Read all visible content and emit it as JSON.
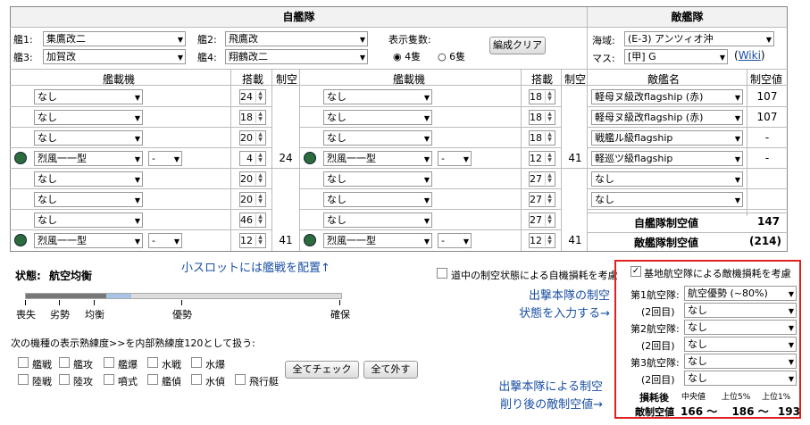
{
  "headers": {
    "own_fleet": "自艦隊",
    "enemy_fleet": "敵艦隊"
  },
  "ship_slots": {
    "ship1_label": "艦1:",
    "ship1_value": "集鷹改二",
    "ship2_label": "艦2:",
    "ship2_value": "飛鷹改",
    "ship3_label": "艦3:",
    "ship3_value": "加賀改",
    "ship4_label": "艦4:",
    "ship4_value": "翔鶴改二"
  },
  "display_count": {
    "label": "表示隻数:",
    "opt4": "4隻",
    "opt6": "6隻"
  },
  "clear_button": "編成クリア",
  "sea_area": {
    "label": "海域:",
    "value": "(E-3) アンツィオ沖"
  },
  "cell": {
    "label": "マス:",
    "value": "[甲] G",
    "wiki": "Wiki",
    "paren_open": "(",
    "paren_close": ")"
  },
  "columns": {
    "aircraft": "艦載機",
    "slots": "搭載",
    "air_control": "制空",
    "enemy_name": "敵艦名",
    "enemy_air": "制空値"
  },
  "left_ship_a": {
    "rows": [
      {
        "plane": "なし",
        "slots": "24"
      },
      {
        "plane": "なし",
        "slots": "18"
      },
      {
        "plane": "なし",
        "slots": "20"
      },
      {
        "plane": "烈風一一型",
        "prof": "-",
        "slots": "4"
      }
    ],
    "air": "24"
  },
  "left_ship_b": {
    "rows": [
      {
        "plane": "なし",
        "slots": "20"
      },
      {
        "plane": "なし",
        "slots": "20"
      },
      {
        "plane": "なし",
        "slots": "46"
      },
      {
        "plane": "烈風一一型",
        "prof": "-",
        "slots": "12"
      }
    ],
    "air": "41"
  },
  "right_ship_a": {
    "rows": [
      {
        "plane": "なし",
        "slots": "18"
      },
      {
        "plane": "なし",
        "slots": "18"
      },
      {
        "plane": "なし",
        "slots": "18"
      },
      {
        "plane": "烈風一一型",
        "prof": "-",
        "slots": "12"
      }
    ],
    "air": "41"
  },
  "right_ship_b": {
    "rows": [
      {
        "plane": "なし",
        "slots": "27"
      },
      {
        "plane": "なし",
        "slots": "27"
      },
      {
        "plane": "なし",
        "slots": "27"
      },
      {
        "plane": "烈風一一型",
        "prof": "-",
        "slots": "12"
      }
    ],
    "air": "41"
  },
  "enemies": [
    {
      "name": "軽母ヌ級改flagship (赤)",
      "air": "107"
    },
    {
      "name": "軽母ヌ級改flagship (赤)",
      "air": "107"
    },
    {
      "name": "戦艦ル級flagship",
      "air": "-"
    },
    {
      "name": "軽巡ツ級flagship",
      "air": "-"
    },
    {
      "name": "なし",
      "air": ""
    },
    {
      "name": "なし",
      "air": ""
    }
  ],
  "totals": {
    "own_label": "自艦隊制空値",
    "own_value": "147",
    "enemy_label": "敵艦隊制空値",
    "enemy_value": "(214)"
  },
  "status": {
    "label": "状態:",
    "value": "航空均衡"
  },
  "gauge_labels": [
    "喪失",
    "劣勢",
    "均衡",
    "優勢",
    "確保"
  ],
  "notes": {
    "small_slot": "小スロットには艦戦を配置↑",
    "input_state": "出撃本隊の制空\n状態を入力する→",
    "after_cut": "出撃本隊による制空\n削り後の敵制空値→"
  },
  "midway_checkbox": "道中の制空状態による自機損耗を考慮",
  "land_base": {
    "checkbox": "基地航空隊による敵機損耗を考慮",
    "rows": [
      {
        "label": "第1航空隊:",
        "value": "航空優勢 (~80%)"
      },
      {
        "label": "(2回目)",
        "value": "なし"
      },
      {
        "label": "第2航空隊:",
        "value": "なし"
      },
      {
        "label": "(2回目)",
        "value": "なし"
      },
      {
        "label": "第3航空隊:",
        "value": "なし"
      },
      {
        "label": "(2回目)",
        "value": "なし"
      }
    ],
    "result_head": {
      "l1": "損耗後",
      "l2": "敵制空値",
      "mid": "中央値",
      "top5": "上位5%",
      "top1": "上位1%"
    },
    "result_values": {
      "mid": "166",
      "top5": "186",
      "top1": "193",
      "sep": "〜"
    }
  },
  "proficiency": {
    "text": "次の機種の表示熟練度>>を内部熟練度120として扱う:",
    "types": [
      "艦戦",
      "艦攻",
      "艦爆",
      "水戦",
      "水爆",
      "陸戦",
      "陸攻",
      "噴式",
      "艦偵",
      "水偵",
      "飛行艇"
    ],
    "check_all": "全てチェック",
    "uncheck_all": "全て外す"
  },
  "colors": {
    "accent_red": "#e02020",
    "note_blue": "#1a4fa3"
  }
}
